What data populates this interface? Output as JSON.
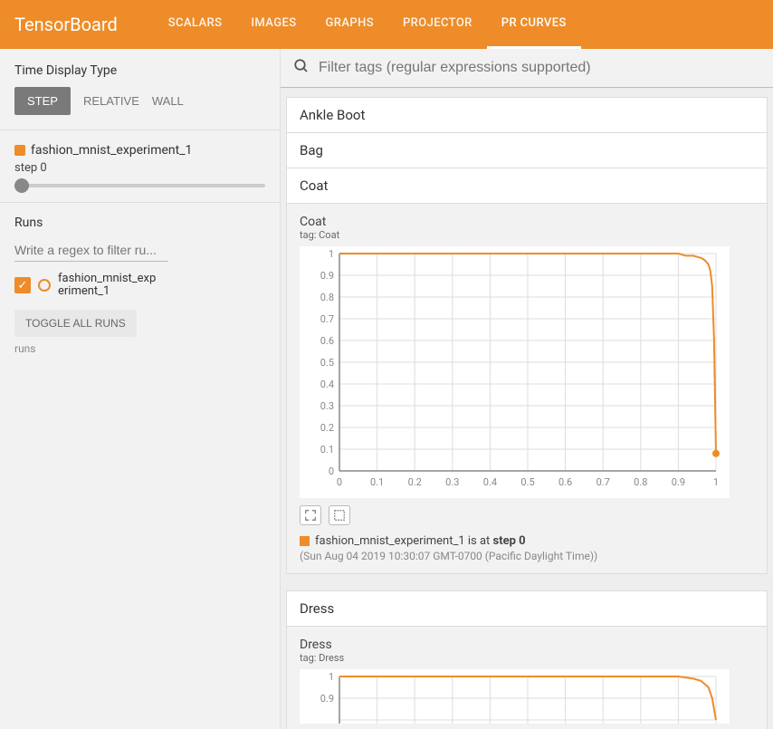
{
  "brand": "TensorBoard",
  "nav": {
    "scalars": "SCALARS",
    "images": "IMAGES",
    "graphs": "GRAPHS",
    "projector": "PROJECTOR",
    "prcurves": "PR CURVES"
  },
  "sidebar": {
    "time_display_label": "Time Display Type",
    "step_btn": "STEP",
    "relative_btn": "RELATIVE",
    "wall_btn": "WALL",
    "run_header": "fashion_mnist_experiment_1",
    "step_label": "step 0",
    "runs_label": "Runs",
    "filter_placeholder": "Write a regex to filter ru...",
    "run_item": "fashion_mnist_experiment_1",
    "toggle_btn": "TOGGLE ALL RUNS",
    "runs_footer": "runs"
  },
  "search": {
    "placeholder": "Filter tags (regular expressions supported)"
  },
  "accordions": {
    "ankle": "Ankle Boot",
    "bag": "Bag",
    "coat": "Coat",
    "dress": "Dress"
  },
  "coat_panel": {
    "title": "Coat",
    "tagline": "tag: Coat",
    "caption_run": "fashion_mnist_experiment_1",
    "caption_mid": " is at ",
    "caption_step": "step 0",
    "timestamp": "(Sun Aug 04 2019 10:30:07 GMT-0700 (Pacific Daylight Time))"
  },
  "dress_panel": {
    "title": "Dress",
    "tagline": "tag: Dress"
  },
  "chart_data": [
    {
      "type": "line",
      "title": "Coat",
      "subtitle": "tag: Coat",
      "xlabel": "",
      "ylabel": "",
      "xlim": [
        0,
        1
      ],
      "ylim": [
        0,
        1
      ],
      "xticks": [
        0,
        0.1,
        0.2,
        0.3,
        0.4,
        0.5,
        0.6,
        0.7,
        0.8,
        0.9,
        1
      ],
      "yticks": [
        0,
        0.1,
        0.2,
        0.3,
        0.4,
        0.5,
        0.6,
        0.7,
        0.8,
        0.9,
        1
      ],
      "series": [
        {
          "name": "fashion_mnist_experiment_1",
          "color": "#ed8c29",
          "x": [
            0.0,
            0.8,
            0.85,
            0.9,
            0.92,
            0.94,
            0.96,
            0.97,
            0.98,
            0.985,
            0.99,
            0.995,
            1.0
          ],
          "y": [
            1.0,
            1.0,
            1.0,
            1.0,
            0.99,
            0.99,
            0.98,
            0.97,
            0.95,
            0.92,
            0.85,
            0.6,
            0.08
          ]
        }
      ],
      "end_marker": {
        "x": 1.0,
        "y": 0.08
      }
    },
    {
      "type": "line",
      "title": "Dress",
      "subtitle": "tag: Dress",
      "xlabel": "",
      "ylabel": "",
      "xlim": [
        0,
        1
      ],
      "ylim": [
        0,
        1
      ],
      "yticks_visible": [
        0.9,
        1
      ],
      "series": [
        {
          "name": "fashion_mnist_experiment_1",
          "color": "#ed8c29",
          "x": [
            0.0,
            0.8,
            0.9,
            0.94,
            0.96,
            0.98,
            0.99,
            1.0
          ],
          "y": [
            1.0,
            1.0,
            1.0,
            0.99,
            0.98,
            0.95,
            0.9,
            0.8
          ]
        }
      ]
    }
  ]
}
